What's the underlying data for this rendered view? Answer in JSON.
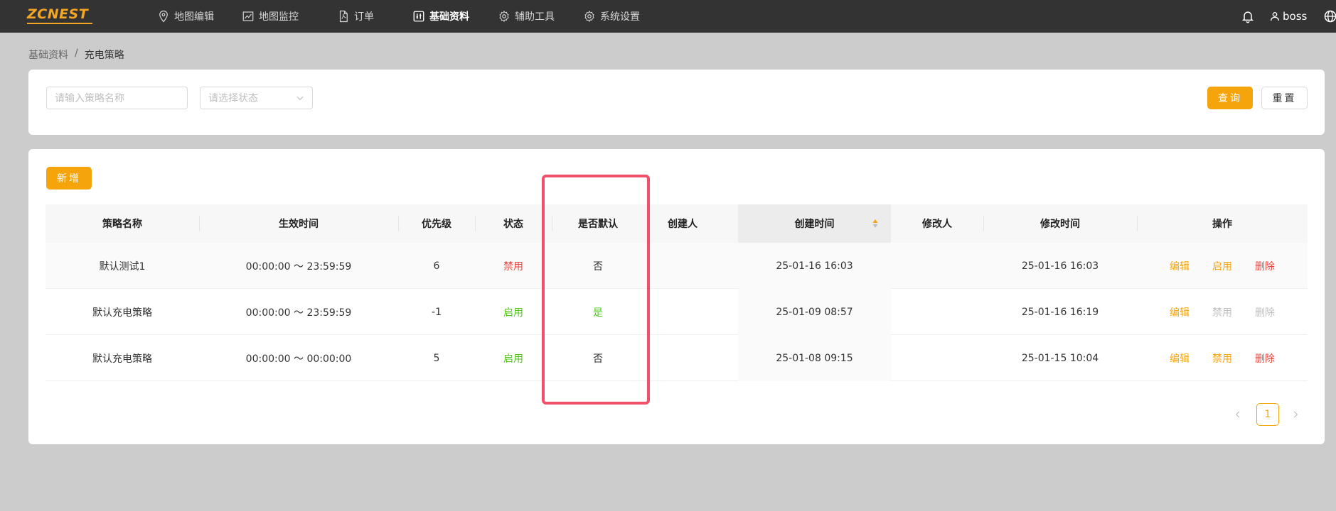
{
  "app": {
    "logo_text": "ZCNEST",
    "brand_color": "#f5a623"
  },
  "nav": [
    {
      "label": "地图编辑",
      "icon": "map-pin-icon"
    },
    {
      "label": "地图监控",
      "icon": "line-chart-icon"
    },
    {
      "label": "订单",
      "icon": "file-pdf-icon"
    },
    {
      "label": "基础资料",
      "icon": "sliders-icon",
      "active": true
    },
    {
      "label": "辅助工具",
      "icon": "gear-icon"
    },
    {
      "label": "系统设置",
      "icon": "gear-icon"
    }
  ],
  "header": {
    "username": "boss",
    "icons": [
      "bell-icon",
      "user-icon",
      "globe-icon"
    ]
  },
  "breadcrumb": {
    "parent": "基础资料",
    "separator": "/",
    "current": "充电策略"
  },
  "search": {
    "name_placeholder": "请输入策略名称",
    "status_placeholder": "请选择状态",
    "query_label": "查询",
    "reset_label": "重置"
  },
  "toolbar": {
    "add_label": "新增"
  },
  "table": {
    "columns": [
      "策略名称",
      "生效时间",
      "优先级",
      "状态",
      "是否默认",
      "创建人",
      "创建时间",
      "修改人",
      "修改时间",
      "操作"
    ],
    "sorted_column": "创建时间",
    "rows": [
      {
        "name": "默认测试1",
        "time": "00:00:00 ～ 23:59:59",
        "priority": "6",
        "status": "禁用",
        "is_default": "否",
        "creator": "",
        "created": "25-01-16 16:03",
        "modifier": "",
        "modified": "25-01-16 16:03",
        "actions": [
          "编辑",
          "启用",
          "删除"
        ]
      },
      {
        "name": "默认充电策略",
        "time": "00:00:00 ～ 23:59:59",
        "priority": "-1",
        "status": "启用",
        "is_default": "是",
        "creator": "",
        "created": "25-01-09 08:57",
        "modifier": "",
        "modified": "25-01-16 16:19",
        "actions": [
          "编辑",
          "禁用",
          "删除"
        ]
      },
      {
        "name": "默认充电策略",
        "time": "00:00:00 ～ 00:00:00",
        "priority": "5",
        "status": "启用",
        "is_default": "否",
        "creator": "",
        "created": "25-01-08 09:15",
        "modifier": "",
        "modified": "25-01-15 10:04",
        "actions": [
          "编辑",
          "禁用",
          "删除"
        ]
      }
    ]
  },
  "pagination": {
    "current_page": "1"
  },
  "colors": {
    "accent": "#f5a40b",
    "danger": "#e8473d",
    "success": "#52c41a",
    "highlight_box": "#f0506a"
  }
}
